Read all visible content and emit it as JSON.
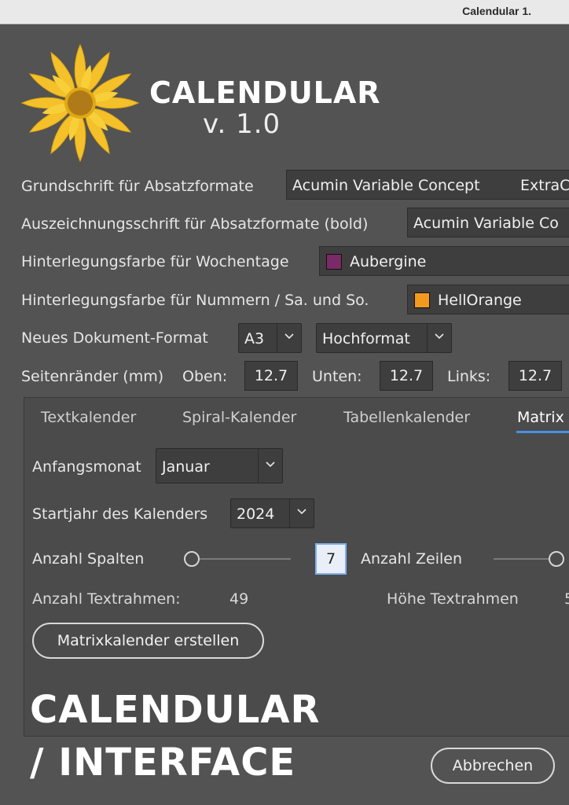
{
  "window": {
    "title": "Calendular 1."
  },
  "brand": {
    "name": "CALENDULAR",
    "version": "v. 1.0"
  },
  "colors": {
    "aubergine": "#7a2a66",
    "hellorange": "#f39a1e",
    "accent": "#4a90e2",
    "petal": "#f4c12a",
    "center": "#b07a18"
  },
  "form": {
    "grundschrift": {
      "label": "Grundschrift für Absatzformate",
      "value": "Acumin Variable Concept",
      "style": "ExtraC"
    },
    "auszeichnung": {
      "label": "Auszeichnungsschrift für Absatzformate (bold)",
      "value": "Acumin Variable Co"
    },
    "wochentage": {
      "label": "Hinterlegungsfarbe für Wochentage",
      "value": "Aubergine"
    },
    "nummern": {
      "label": "Hinterlegungsfarbe für Nummern / Sa. und So.",
      "value": "HellOrange"
    },
    "dokument": {
      "label": "Neues Dokument-Format",
      "format": "A3",
      "orientation": "Hochformat"
    },
    "raender": {
      "label": "Seitenränder (mm)",
      "oben_label": "Oben:",
      "oben": "12.7",
      "unten_label": "Unten:",
      "unten": "12.7",
      "links_label": "Links:",
      "links": "12.7"
    }
  },
  "tabs": [
    "Textkalender",
    "Spiral-Kalender",
    "Tabellenkalender",
    "Matrix"
  ],
  "matrix": {
    "anfangsmonat_label": "Anfangsmonat",
    "anfangsmonat": "Januar",
    "startjahr_label": "Startjahr des Kalenders",
    "startjahr": "2024",
    "spalten_label": "Anzahl Spalten",
    "spalten": "7",
    "zeilen_label": "Anzahl Zeilen",
    "textrahmen_label": "Anzahl Textrahmen:",
    "textrahmen": "49",
    "hoehe_label": "Höhe Textrahmen",
    "hoehe": "5",
    "create_label": "Matrixkalender erstellen"
  },
  "footer": {
    "line1": "CALENDULAR",
    "line2": "/ INTERFACE",
    "cancel_label": "Abbrechen"
  }
}
